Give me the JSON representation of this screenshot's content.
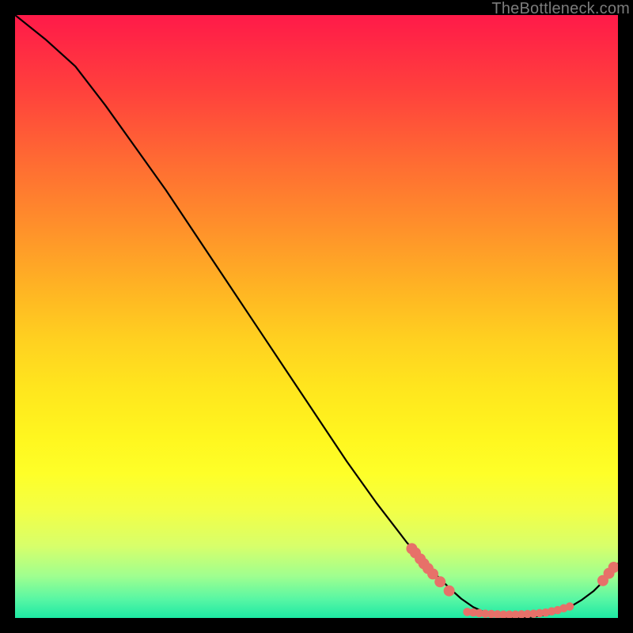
{
  "watermark": "TheBottleneck.com",
  "chart_data": {
    "type": "line",
    "title": "",
    "xlabel": "",
    "ylabel": "",
    "xlim": [
      0,
      100
    ],
    "ylim": [
      0,
      100
    ],
    "series": [
      {
        "name": "curve",
        "x": [
          0,
          5,
          10,
          15,
          20,
          25,
          30,
          35,
          40,
          45,
          50,
          55,
          60,
          65,
          70,
          72,
          74,
          76,
          78,
          80,
          82,
          84,
          86,
          88,
          90,
          92,
          94,
          96,
          98,
          100
        ],
        "y": [
          100,
          96,
          91.5,
          85,
          78,
          71,
          63.5,
          56,
          48.5,
          41,
          33.5,
          26,
          19,
          12.5,
          7,
          5,
          3.2,
          1.8,
          0.9,
          0.3,
          0.1,
          0.1,
          0.2,
          0.5,
          1.0,
          1.8,
          3.0,
          4.5,
          6.5,
          9
        ]
      }
    ],
    "markers": [
      {
        "x": 65.8,
        "y": 11.5,
        "r": 1.0
      },
      {
        "x": 66.4,
        "y": 10.8,
        "r": 1.0
      },
      {
        "x": 67.2,
        "y": 9.8,
        "r": 1.0
      },
      {
        "x": 67.8,
        "y": 9.0,
        "r": 1.0
      },
      {
        "x": 68.5,
        "y": 8.2,
        "r": 1.0
      },
      {
        "x": 69.3,
        "y": 7.3,
        "r": 1.0
      },
      {
        "x": 70.5,
        "y": 6.0,
        "r": 1.0
      },
      {
        "x": 72.0,
        "y": 4.5,
        "r": 1.0
      },
      {
        "x": 75.0,
        "y": 1.0,
        "r": 0.75
      },
      {
        "x": 76.0,
        "y": 0.9,
        "r": 0.75
      },
      {
        "x": 77.0,
        "y": 0.8,
        "r": 0.75
      },
      {
        "x": 78.0,
        "y": 0.7,
        "r": 0.75
      },
      {
        "x": 79.0,
        "y": 0.65,
        "r": 0.75
      },
      {
        "x": 80.0,
        "y": 0.6,
        "r": 0.75
      },
      {
        "x": 81.0,
        "y": 0.55,
        "r": 0.75
      },
      {
        "x": 82.0,
        "y": 0.55,
        "r": 0.75
      },
      {
        "x": 83.0,
        "y": 0.55,
        "r": 0.75
      },
      {
        "x": 84.0,
        "y": 0.6,
        "r": 0.75
      },
      {
        "x": 85.0,
        "y": 0.65,
        "r": 0.75
      },
      {
        "x": 86.0,
        "y": 0.7,
        "r": 0.75
      },
      {
        "x": 87.0,
        "y": 0.8,
        "r": 0.75
      },
      {
        "x": 88.0,
        "y": 0.9,
        "r": 0.75
      },
      {
        "x": 89.0,
        "y": 1.1,
        "r": 0.75
      },
      {
        "x": 90.0,
        "y": 1.3,
        "r": 0.75
      },
      {
        "x": 91.0,
        "y": 1.6,
        "r": 0.75
      },
      {
        "x": 92.0,
        "y": 1.9,
        "r": 0.75
      },
      {
        "x": 97.5,
        "y": 6.2,
        "r": 1.0
      },
      {
        "x": 98.5,
        "y": 7.4,
        "r": 1.0
      },
      {
        "x": 99.3,
        "y": 8.4,
        "r": 1.0
      }
    ],
    "colors": {
      "line": "#000000",
      "marker": "#e77169"
    }
  }
}
